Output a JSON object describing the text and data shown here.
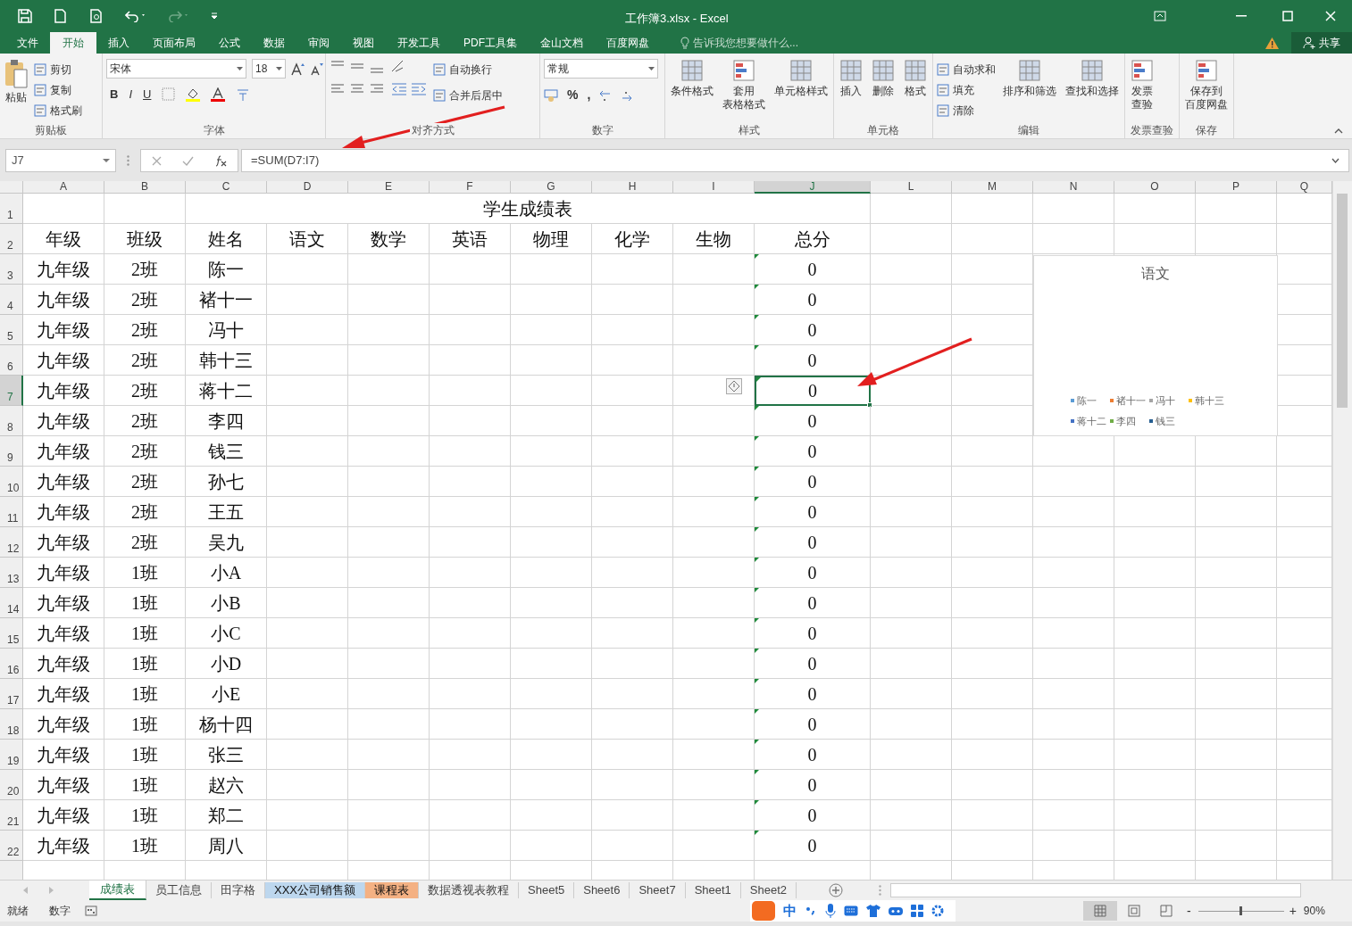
{
  "window": {
    "title": "工作簿3.xlsx - Excel"
  },
  "menu_tabs": [
    {
      "label": "文件",
      "selected": false
    },
    {
      "label": "开始",
      "selected": true
    },
    {
      "label": "插入",
      "selected": false
    },
    {
      "label": "页面布局",
      "selected": false
    },
    {
      "label": "公式",
      "selected": false
    },
    {
      "label": "数据",
      "selected": false
    },
    {
      "label": "审阅",
      "selected": false
    },
    {
      "label": "视图",
      "selected": false
    },
    {
      "label": "开发工具",
      "selected": false
    },
    {
      "label": "PDF工具集",
      "selected": false
    },
    {
      "label": "金山文档",
      "selected": false
    },
    {
      "label": "百度网盘",
      "selected": false
    }
  ],
  "tell_me": {
    "placeholder": "告诉我您想要做什么..."
  },
  "share": "共享",
  "ribbon": [
    {
      "kind": "clipboard",
      "label": "剪贴板",
      "large": "粘贴",
      "small": [
        "剪切",
        "复制",
        "格式刷"
      ]
    },
    {
      "kind": "font",
      "label": "字体",
      "font_name": "宋体",
      "font_size": "18",
      "buttons": [
        "B",
        "I",
        "U"
      ]
    },
    {
      "kind": "alignment",
      "label": "对齐方式",
      "small": [
        "自动换行",
        "合并后居中"
      ]
    },
    {
      "kind": "number",
      "label": "数字",
      "format": "常规",
      "glyphs": [
        "%",
        ","
      ]
    },
    {
      "kind": "large",
      "label": "样式",
      "large": [
        [
          "条件格式"
        ],
        [
          "套用",
          "表格格式"
        ],
        [
          "单元格样式"
        ]
      ]
    },
    {
      "kind": "large",
      "label": "单元格",
      "large": [
        [
          "插入"
        ],
        [
          "删除"
        ],
        [
          "格式"
        ]
      ]
    },
    {
      "kind": "editing",
      "label": "编辑",
      "small": [
        "自动求和",
        "填充",
        "清除"
      ],
      "large": [
        [
          "排序和筛选"
        ],
        [
          "查找和选择"
        ]
      ]
    },
    {
      "kind": "large",
      "label": "发票查验",
      "large": [
        [
          "发票",
          "查验"
        ]
      ]
    },
    {
      "kind": "large",
      "label": "保存",
      "large": [
        [
          "保存到",
          "百度网盘"
        ]
      ]
    }
  ],
  "formula_bar": {
    "name_box": "J7",
    "formula": "=SUM(D7:I7)"
  },
  "sheet": {
    "columns": [
      {
        "label": "A",
        "selected": false
      },
      {
        "label": "B",
        "selected": false
      },
      {
        "label": "C",
        "selected": false
      },
      {
        "label": "D",
        "selected": false
      },
      {
        "label": "E",
        "selected": false
      },
      {
        "label": "F",
        "selected": false
      },
      {
        "label": "G",
        "selected": false
      },
      {
        "label": "H",
        "selected": false
      },
      {
        "label": "I",
        "selected": false
      },
      {
        "label": "J",
        "selected": true
      },
      {
        "label": "L",
        "selected": false
      },
      {
        "label": "M",
        "selected": false
      },
      {
        "label": "N",
        "selected": false
      },
      {
        "label": "O",
        "selected": false
      },
      {
        "label": "P",
        "selected": false
      },
      {
        "label": "Q",
        "selected": false
      }
    ],
    "title_row": {
      "number": "1",
      "title": "学生成绩表"
    },
    "header_row": {
      "number": "2",
      "cells": [
        "年级",
        "班级",
        "姓名",
        "语文",
        "数学",
        "英语",
        "物理",
        "化学",
        "生物",
        "总分"
      ]
    },
    "rows": [
      {
        "number": "3",
        "grade": "九年级",
        "class": "2班",
        "name": "陈一",
        "total": "0",
        "selected": false
      },
      {
        "number": "4",
        "grade": "九年级",
        "class": "2班",
        "name": "褚十一",
        "total": "0",
        "selected": false
      },
      {
        "number": "5",
        "grade": "九年级",
        "class": "2班",
        "name": "冯十",
        "total": "0",
        "selected": false
      },
      {
        "number": "6",
        "grade": "九年级",
        "class": "2班",
        "name": "韩十三",
        "total": "0",
        "selected": false
      },
      {
        "number": "7",
        "grade": "九年级",
        "class": "2班",
        "name": "蒋十二",
        "total": "0",
        "selected": true
      },
      {
        "number": "8",
        "grade": "九年级",
        "class": "2班",
        "name": "李四",
        "total": "0",
        "selected": false
      },
      {
        "number": "9",
        "grade": "九年级",
        "class": "2班",
        "name": "钱三",
        "total": "0",
        "selected": false
      },
      {
        "number": "10",
        "grade": "九年级",
        "class": "2班",
        "name": "孙七",
        "total": "0",
        "selected": false
      },
      {
        "number": "11",
        "grade": "九年级",
        "class": "2班",
        "name": "王五",
        "total": "0",
        "selected": false
      },
      {
        "number": "12",
        "grade": "九年级",
        "class": "2班",
        "name": "吴九",
        "total": "0",
        "selected": false
      },
      {
        "number": "13",
        "grade": "九年级",
        "class": "1班",
        "name": "小A",
        "total": "0",
        "selected": false
      },
      {
        "number": "14",
        "grade": "九年级",
        "class": "1班",
        "name": "小B",
        "total": "0",
        "selected": false
      },
      {
        "number": "15",
        "grade": "九年级",
        "class": "1班",
        "name": "小C",
        "total": "0",
        "selected": false
      },
      {
        "number": "16",
        "grade": "九年级",
        "class": "1班",
        "name": "小D",
        "total": "0",
        "selected": false
      },
      {
        "number": "17",
        "grade": "九年级",
        "class": "1班",
        "name": "小E",
        "total": "0",
        "selected": false
      },
      {
        "number": "18",
        "grade": "九年级",
        "class": "1班",
        "name": "杨十四",
        "total": "0",
        "selected": false
      },
      {
        "number": "19",
        "grade": "九年级",
        "class": "1班",
        "name": "张三",
        "total": "0",
        "selected": false
      },
      {
        "number": "20",
        "grade": "九年级",
        "class": "1班",
        "name": "赵六",
        "total": "0",
        "selected": false
      },
      {
        "number": "21",
        "grade": "九年级",
        "class": "1班",
        "name": "郑二",
        "total": "0",
        "selected": false
      },
      {
        "number": "22",
        "grade": "九年级",
        "class": "1班",
        "name": "周八",
        "total": "0",
        "selected": false
      }
    ],
    "chart": {
      "title": "语文",
      "legend": [
        {
          "label": "陈一",
          "color": "#5b9bd5"
        },
        {
          "label": "褚十一",
          "color": "#ed7d31"
        },
        {
          "label": "冯十",
          "color": "#a5a5a5"
        },
        {
          "label": "韩十三",
          "color": "#ffc000"
        },
        {
          "label": "蒋十二",
          "color": "#4472c4"
        },
        {
          "label": "李四",
          "color": "#70ad47"
        },
        {
          "label": "钱三",
          "color": "#255e91"
        }
      ]
    }
  },
  "sheet_tabs": [
    {
      "label": "成绩表",
      "selected": true
    },
    {
      "label": "员工信息",
      "selected": false
    },
    {
      "label": "田字格",
      "selected": false
    },
    {
      "label": "XXX公司销售额",
      "selected": false,
      "color": "#bdd7ee"
    },
    {
      "label": "课程表",
      "selected": false,
      "color": "#f4b183"
    },
    {
      "label": "数据透视表教程",
      "selected": false
    },
    {
      "label": "Sheet5",
      "selected": false
    },
    {
      "label": "Sheet6",
      "selected": false
    },
    {
      "label": "Sheet7",
      "selected": false
    },
    {
      "label": "Sheet1",
      "selected": false
    },
    {
      "label": "Sheet2",
      "selected": false
    }
  ],
  "status_bar": {
    "ready": "就绪",
    "mode": "数字",
    "ime": "中",
    "zoom_out": "-",
    "zoom_in": "+",
    "zoom": "90%",
    "zoom_slider": {
      "level": 0.5
    }
  }
}
